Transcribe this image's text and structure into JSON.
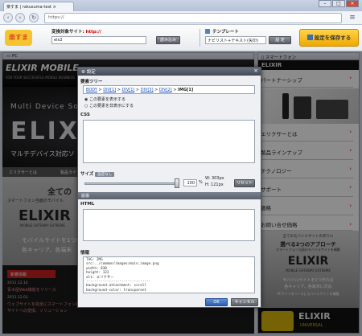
{
  "browser": {
    "tab_title": "楽すま | rakusuma-test",
    "url": "https://",
    "win_min": "–",
    "win_max": "□",
    "win_close": "×"
  },
  "toolbar": {
    "logo": "楽すま",
    "site_label": "変換対象サイト: ",
    "site_prefix": "http://",
    "site_value": "elx2",
    "load_button": "読み込み",
    "template_label": "テンプレート",
    "template_value": "ナビリスト+テキスト(矢印)",
    "set_button": "設 定",
    "save_button": "設定を保存する"
  },
  "panes": {
    "pc_label": "PC",
    "sp_label": "スマートフォン"
  },
  "pc": {
    "brand": "ELIXIR MOBILE",
    "tagline": "FOR YOUR SUCCESSFUL MOBILE BUSINESS",
    "hero_title": "Multi Device Solution",
    "hero_logo": "ELIXIR",
    "hero_sub": "マルチデバイス対応ソ",
    "nav_items": [
      "エリクサーとは",
      "製品ラインナ"
    ],
    "mid_heading": "全ての",
    "mid_sub": "スマートフォン当面のモバイル",
    "mid_logo": "ELIXIR",
    "mid_sub2": "MOBILE GATEWAY EXTREME",
    "mid_text": "モバイルサイトを1つ作れ",
    "mid_text2": "各キャリア、各端末",
    "news_label": "新着情報",
    "news_items": [
      {
        "date": "2011.12.14",
        "text": "青木屋Web機能をリリース"
      },
      {
        "date": "2011.12.01",
        "text": "ウェブサイトを完全にスマートフォン向け"
      },
      {
        "date": "",
        "text": "サイトへの変換、ソリューション"
      }
    ]
  },
  "sp": {
    "header_logo": "ELIXIR",
    "items": [
      "パートナーシップ",
      "エリクサーとは",
      "製品ラインナップ",
      "テクノロジー",
      "サポート",
      "価格",
      "お問い合せ価格"
    ],
    "banner_title": "全てのモバイルサイトの作りに",
    "banner_big": "選べる2つのアプローチ",
    "banner_sub": "スマートフォン当面のモバイルサイトを構築",
    "banner_logo": "ELIXIR",
    "banner_logo_sub": "MOBILE GATEWAY EXTREME",
    "banner_text": "モバイルサイトを1つ作れば",
    "banner_text2": "各キャリア、各端末に対応",
    "banner_text3": "PCサイトをベースにモバイルサイトを構築",
    "footer_logo": "ELIXIR",
    "footer_logo_sub": "UNIVERSAL"
  },
  "dialog": {
    "title": "設定",
    "close": "×",
    "tree_label": "要素ツリー",
    "breadcrumb": [
      "BODY",
      "DIV[1]",
      "DIV[1]",
      "DIV[3]",
      "DIV[2]",
      "IMG[1]"
    ],
    "radio_show": "この要素を表示する",
    "radio_hide": "この要素を非表示にする",
    "css_label": "CSS",
    "size_label": "サイズ",
    "size_badge": "設定なし",
    "size_value": "100",
    "size_unit": "%",
    "width_label": "W:",
    "width_value": "303px",
    "height_label": "H:",
    "height_value": "121px",
    "reset_button": "リセット",
    "ext_label": "拡張",
    "html_label": "HTML",
    "info_label": "情報",
    "info_lines": [
      "TAG: IMG",
      "src:../common/images/main_image.png",
      "width: 830",
      "height: 122",
      "alt: エリクサー",
      "-------------------------------",
      "background-attachment: scroll",
      "background-color: transparent"
    ],
    "ok_button": "OK",
    "cancel_button": "キャンセル"
  }
}
